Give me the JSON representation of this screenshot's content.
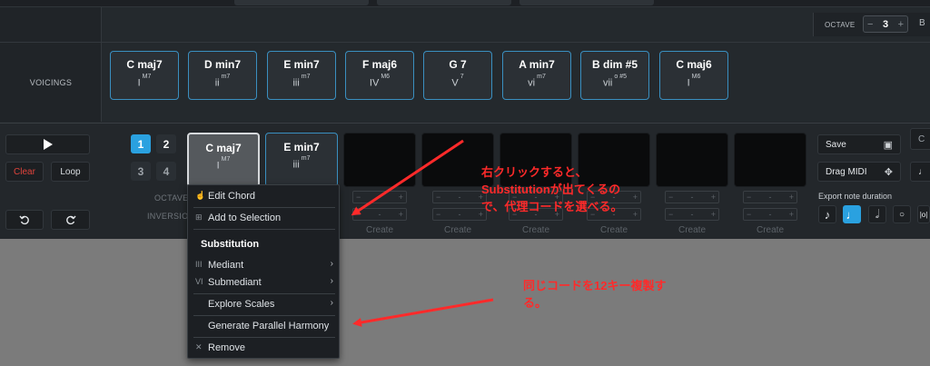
{
  "header": {
    "octave_label": "OCTAVE",
    "octave_value": "3",
    "octave_minus": "−",
    "octave_plus": "+",
    "cut_letter": "B"
  },
  "voicings": {
    "label": "VOICINGS",
    "chords": [
      {
        "name": "C maj7",
        "roman": "I",
        "sup": "M7"
      },
      {
        "name": "D min7",
        "roman": "ii",
        "sup": "m7"
      },
      {
        "name": "E min7",
        "roman": "iii",
        "sup": "m7"
      },
      {
        "name": "F maj6",
        "roman": "IV",
        "sup": "M6"
      },
      {
        "name": "G 7",
        "roman": "V",
        "sup": "7"
      },
      {
        "name": "A min7",
        "roman": "vi",
        "sup": "m7"
      },
      {
        "name": "B dim #5",
        "roman": "vii",
        "sup": "o #5"
      },
      {
        "name": "C maj6",
        "roman": "I",
        "sup": "M6"
      }
    ]
  },
  "transport": {
    "clear": "Clear",
    "loop": "Loop"
  },
  "pages": [
    "1",
    "2",
    "3",
    "4"
  ],
  "side_labels": {
    "octave": "OCTAVE",
    "inversion": "INVERSION"
  },
  "slots": {
    "filled": [
      {
        "name": "C maj7",
        "roman": "I",
        "sup": "M7"
      },
      {
        "name": "E min7",
        "roman": "iii",
        "sup": "m7"
      }
    ],
    "create_label": "Create",
    "stepper_value": "-",
    "stepper_minus": "−",
    "stepper_plus": "+"
  },
  "right_panel": {
    "save": "Save",
    "drag_midi": "Drag MIDI",
    "export_label": "Export note duration"
  },
  "context_menu": {
    "edit_chord": "Edit Chord",
    "add_to_selection": "Add to Selection",
    "substitution_heading": "Substitution",
    "mediant": "Mediant",
    "mediant_prefix": "III",
    "submediant": "Submediant",
    "submediant_prefix": "VI",
    "explore_scales": "Explore Scales",
    "generate_parallel": "Generate Parallel Harmony",
    "remove": "Remove"
  },
  "annotations": {
    "note1_line1": "右クリックすると、",
    "note1_line2": "Substitutionが出てくるの",
    "note1_line3": "で、代理コードを選べる。",
    "note2_line1": "同じコードを12キー複製す",
    "note2_line2": "る。"
  },
  "colors": {
    "accent": "#2aa1e0",
    "annotation": "#ff2a2a",
    "clear_text": "#e0433b"
  }
}
